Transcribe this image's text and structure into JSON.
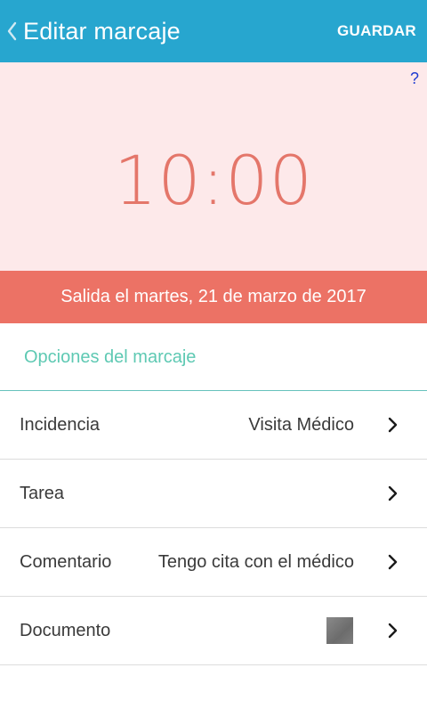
{
  "header": {
    "title": "Editar marcaje",
    "save_label": "GUARDAR",
    "back_icon": "chevron-left-icon",
    "background_color": "#27a6cf"
  },
  "time_panel": {
    "help_label": "?",
    "time": "10:00",
    "background_color": "#fde9ea",
    "time_color": "#e4766a"
  },
  "date_band": {
    "text": "Salida el martes, 21 de marzo de 2017",
    "background_color": "#ec7265"
  },
  "options": {
    "title": "Opciones del marcaje",
    "title_color": "#5ec9b3",
    "rows": [
      {
        "label": "Incidencia",
        "value": "Visita Médico",
        "icon": "chevron-right-icon"
      },
      {
        "label": "Tarea",
        "value": "",
        "icon": "chevron-right-icon"
      },
      {
        "label": "Comentario",
        "value": "Tengo cita con el médico",
        "icon": "chevron-right-icon"
      },
      {
        "label": "Documento",
        "value": "",
        "thumbnail": "document-thumbnail",
        "icon": "chevron-right-icon"
      }
    ]
  }
}
